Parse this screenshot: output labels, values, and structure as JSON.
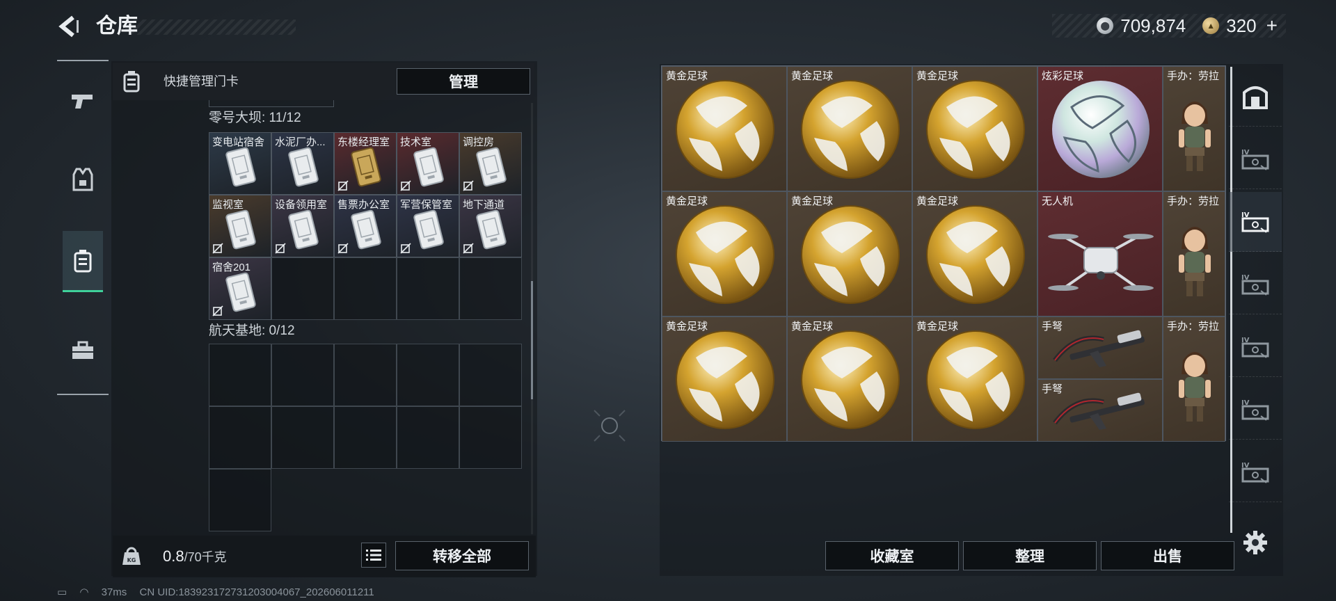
{
  "header": {
    "title": "仓库",
    "currency_silver": "709,874",
    "currency_gold": "320",
    "gold_plus": "+"
  },
  "left_rail": {
    "items": [
      {
        "name": "weapons",
        "icon": "pistol-icon"
      },
      {
        "name": "armor",
        "icon": "vest-icon"
      },
      {
        "name": "keycards",
        "icon": "keycard-case-icon",
        "active": true
      },
      {
        "name": "tools",
        "icon": "toolbox-icon"
      }
    ]
  },
  "quick_manage": {
    "label": "快捷管理门卡",
    "button": "管理"
  },
  "sections": [
    {
      "title": "零号大坝: 11/12",
      "cards": [
        {
          "label": "变电站宿舍",
          "tint": "#2d3a48",
          "gold": false,
          "unbound": false
        },
        {
          "label": "水泥厂办...",
          "tint": "#2c3446",
          "gold": false,
          "unbound": false
        },
        {
          "label": "东楼经理室",
          "tint": "#5a2a2e",
          "gold": true,
          "unbound": true
        },
        {
          "label": "技术室",
          "tint": "#5a2a2e",
          "gold": false,
          "unbound": true
        },
        {
          "label": "调控房",
          "tint": "#4a3b2c",
          "gold": false,
          "unbound": true
        },
        {
          "label": "监视室",
          "tint": "#4a3b2c",
          "gold": false,
          "unbound": true
        },
        {
          "label": "设备领用室",
          "tint": "#3b3544",
          "gold": false,
          "unbound": true
        },
        {
          "label": "售票办公室",
          "tint": "#2e3346",
          "gold": false,
          "unbound": true
        },
        {
          "label": "军营保管室",
          "tint": "#2e3346",
          "gold": false,
          "unbound": true
        },
        {
          "label": "地下通道",
          "tint": "#3b3544",
          "gold": false,
          "unbound": true
        },
        {
          "label": "宿舍201",
          "tint": "#3b3544",
          "gold": false,
          "unbound": true
        }
      ]
    },
    {
      "title": "航天基地: 0/12",
      "cards": []
    }
  ],
  "bottom_bar": {
    "weight_current": "0.8",
    "weight_max": "/70千克",
    "transfer_all": "转移全部"
  },
  "status": {
    "latency": "37ms",
    "uid": "CN UID:18392317273120300406​7_202606011211"
  },
  "inventory": {
    "items": [
      {
        "label": "黄金足球",
        "type": "gold-ball",
        "bg": "brown",
        "col": 0,
        "row": 0
      },
      {
        "label": "黄金足球",
        "type": "gold-ball",
        "bg": "brown",
        "col": 1,
        "row": 0
      },
      {
        "label": "黄金足球",
        "type": "gold-ball",
        "bg": "brown",
        "col": 2,
        "row": 0
      },
      {
        "label": "炫彩足球",
        "type": "iridescent-ball",
        "bg": "red",
        "col": 3,
        "row": 0
      },
      {
        "label": "手办：劳拉",
        "type": "figure",
        "bg": "brown",
        "col": 4,
        "row": 0
      },
      {
        "label": "黄金足球",
        "type": "gold-ball",
        "bg": "brown",
        "col": 0,
        "row": 1
      },
      {
        "label": "黄金足球",
        "type": "gold-ball",
        "bg": "brown",
        "col": 1,
        "row": 1
      },
      {
        "label": "黄金足球",
        "type": "gold-ball",
        "bg": "brown",
        "col": 2,
        "row": 1
      },
      {
        "label": "无人机",
        "type": "drone",
        "bg": "red",
        "col": 3,
        "row": 1
      },
      {
        "label": "手办：劳拉",
        "type": "figure",
        "bg": "brown",
        "col": 4,
        "row": 1
      },
      {
        "label": "黄金足球",
        "type": "gold-ball",
        "bg": "brown",
        "col": 0,
        "row": 2
      },
      {
        "label": "黄金足球",
        "type": "gold-ball",
        "bg": "brown",
        "col": 1,
        "row": 2
      },
      {
        "label": "黄金足球",
        "type": "gold-ball",
        "bg": "brown",
        "col": 2,
        "row": 2
      },
      {
        "label": "手弩",
        "type": "crossbow",
        "bg": "brown",
        "col": 3,
        "row": 2,
        "half": "top"
      },
      {
        "label": "手弩",
        "type": "crossbow",
        "bg": "brown",
        "col": 3,
        "row": 2,
        "half": "bottom"
      },
      {
        "label": "手办：劳拉",
        "type": "figure",
        "bg": "brown",
        "col": 4,
        "row": 2
      }
    ]
  },
  "right_tabs": [
    {
      "icon": "vault-icon"
    },
    {
      "icon": "container-iv-icon"
    },
    {
      "icon": "container-iv-icon",
      "active": true
    },
    {
      "icon": "container-iv-icon"
    },
    {
      "icon": "container-iv-icon"
    },
    {
      "icon": "container-iv-icon"
    },
    {
      "icon": "container-iv-icon"
    }
  ],
  "actions": {
    "collection_room": "收藏室",
    "organize": "整理",
    "sell": "出售"
  }
}
